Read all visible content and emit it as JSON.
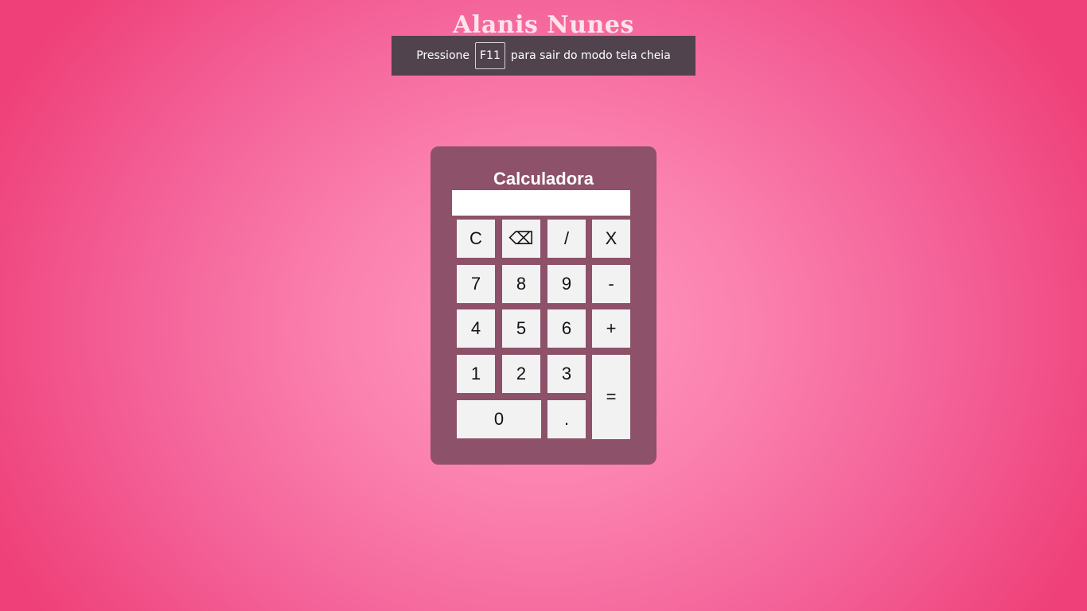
{
  "page": {
    "heading": "Alanis Nunes"
  },
  "fullscreen_notice": {
    "prefix": "Pressione",
    "key": "F11",
    "suffix": "para sair do modo tela cheia"
  },
  "calculator": {
    "title": "Calculadora",
    "display_value": "",
    "buttons": {
      "clear": "C",
      "backspace": "⌫",
      "divide": "/",
      "multiply": "X",
      "seven": "7",
      "eight": "8",
      "nine": "9",
      "subtract": "-",
      "four": "4",
      "five": "5",
      "six": "6",
      "add": "+",
      "one": "1",
      "two": "2",
      "three": "3",
      "equals": "=",
      "zero": "0",
      "decimal": "."
    }
  },
  "colors": {
    "background_center": "#fd9ac0",
    "background_edge": "#ef4079",
    "calculator_body": "#8d5169",
    "button_face": "#f2f2f2",
    "toast_background": "#51434d"
  }
}
